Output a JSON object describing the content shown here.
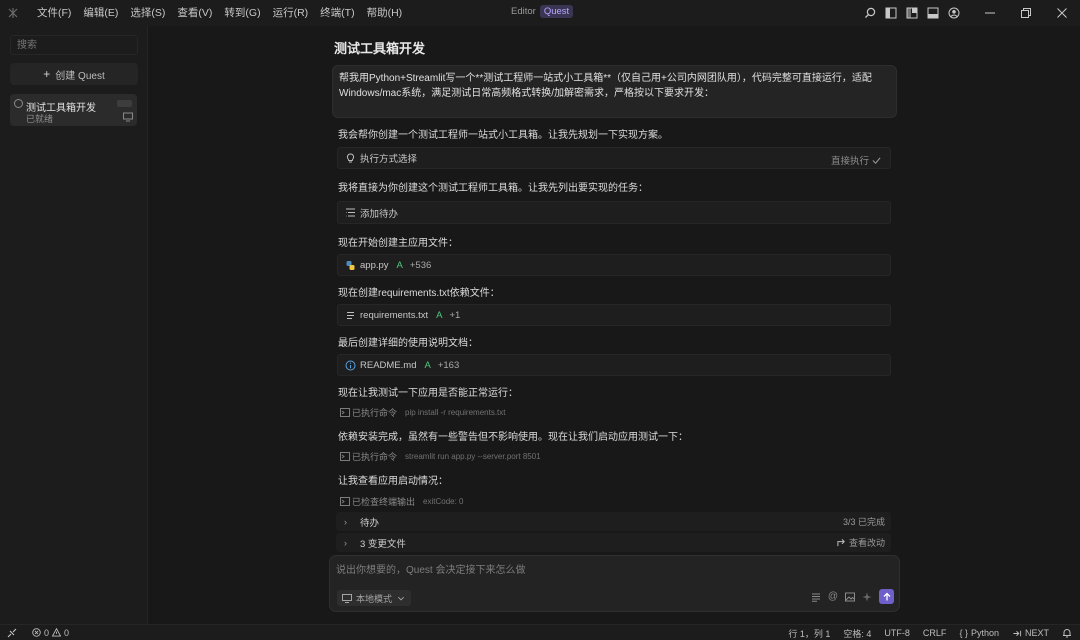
{
  "titlebar": {
    "menu": [
      "文件(F)",
      "编辑(E)",
      "选择(S)",
      "查看(V)",
      "转到(G)",
      "运行(R)",
      "终端(T)",
      "帮助(H)"
    ],
    "mode_editor": "Editor",
    "mode_quest": "Quest"
  },
  "sidebar": {
    "search_placeholder": "搜索",
    "create_quest": "创建 Quest",
    "quest": {
      "title": "测试工具箱开发",
      "status": "已就绪"
    }
  },
  "main": {
    "title": "测试工具箱开发",
    "user_message": "帮我用Python+Streamlit写一个**测试工程师一站式小工具箱**（仅自己用+公司内网团队用），代码完整可直接运行，适配Windows/mac系统，满足测试日常高频格式转换/加解密需求，严格按以下要求开发：",
    "r1": "我会帮你创建一个测试工程师一站式小工具箱。让我先规划一下实现方案。",
    "exec_card": {
      "label": "执行方式选择",
      "value": "直接执行"
    },
    "r2": "我将直接为你创建这个测试工程师工具箱。让我先列出要实现的任务：",
    "todo_card": "添加待办",
    "r3": "现在开始创建主应用文件：",
    "file1": {
      "name": "app.py",
      "status": "A",
      "lines": "+536"
    },
    "r4": "现在创建requirements.txt依赖文件：",
    "file2": {
      "name": "requirements.txt",
      "status": "A",
      "lines": "+1"
    },
    "r5": "最后创建详细的使用说明文档：",
    "file3": {
      "name": "README.md",
      "status": "A",
      "lines": "+163"
    },
    "r6": "现在让我测试一下应用是否能正常运行：",
    "cmd1": {
      "label": "已执行命令",
      "arg": "pip install -r requirements.txt"
    },
    "r7": "依赖安装完成，虽然有一些警告但不影响使用。现在让我们启动应用测试一下：",
    "cmd2": {
      "label": "已执行命令",
      "arg": "streamlit run app.py --server.port 8501"
    },
    "r8": "让我查看应用启动情况：",
    "cmd3": {
      "label": "已检查终端输出",
      "arg": "exitCode: 0"
    },
    "todo_row": {
      "label": "待办",
      "right": "3/3 已完成"
    },
    "changes_row": {
      "label": "3 变更文件",
      "right": "查看改动"
    },
    "input": {
      "placeholder": "说出你想要的，Quest 会决定接下来怎么做",
      "mode": "本地模式"
    }
  },
  "statusbar": {
    "errors": "0",
    "warnings": "0",
    "position": "行 1，列 1",
    "spaces": "空格: 4",
    "encoding": "UTF-8",
    "eol": "CRLF",
    "language": "Python",
    "next": "NEXT"
  },
  "colors": {
    "accent": "#6f5fc8",
    "added": "#4ec97f",
    "background": "#181818"
  }
}
